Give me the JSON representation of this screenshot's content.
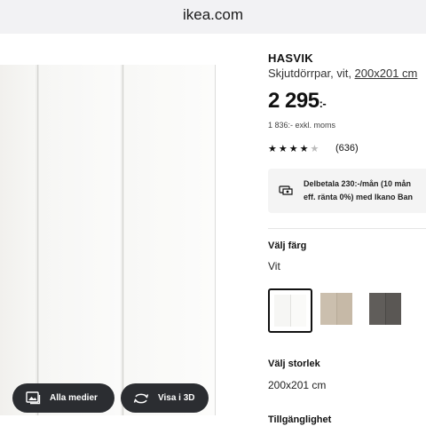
{
  "browser": {
    "url": "ikea.com"
  },
  "gallery": {
    "buttons": [
      {
        "label": "Alla medier",
        "icon": "image-icon"
      },
      {
        "label": "Visa i 3D",
        "icon": "rotate-3d-icon"
      }
    ]
  },
  "product": {
    "name": "HASVIK",
    "description": "Skjutdörrpar, vit, ",
    "size_link": "200x201 cm",
    "price": "2 295",
    "price_suffix": ":-",
    "price_excl": "1 836:- exkl. moms",
    "rating": {
      "stars": 4.5,
      "count": "(636)"
    },
    "financing": {
      "line1": "Delbetala 230:-/mån (10 mån",
      "line2": "eff. ränta 0%) med Ikano Ban",
      "icon": "payment-card-icon"
    }
  },
  "color_section": {
    "label": "Välj färg",
    "value": "Vit",
    "swatches": [
      {
        "name": "Vit",
        "color": "#f4f4f2",
        "selected": true
      },
      {
        "name": "Beige",
        "color": "#c9bcaa",
        "selected": false
      },
      {
        "name": "Grå",
        "color": "#5d5a57",
        "selected": false
      }
    ]
  },
  "size_section": {
    "label": "Välj storlek",
    "value": "200x201 cm"
  },
  "availability_section": {
    "label": "Tillgänglighet"
  },
  "colors": {
    "accent_dark": "#2b2d31",
    "link": "#111111"
  }
}
